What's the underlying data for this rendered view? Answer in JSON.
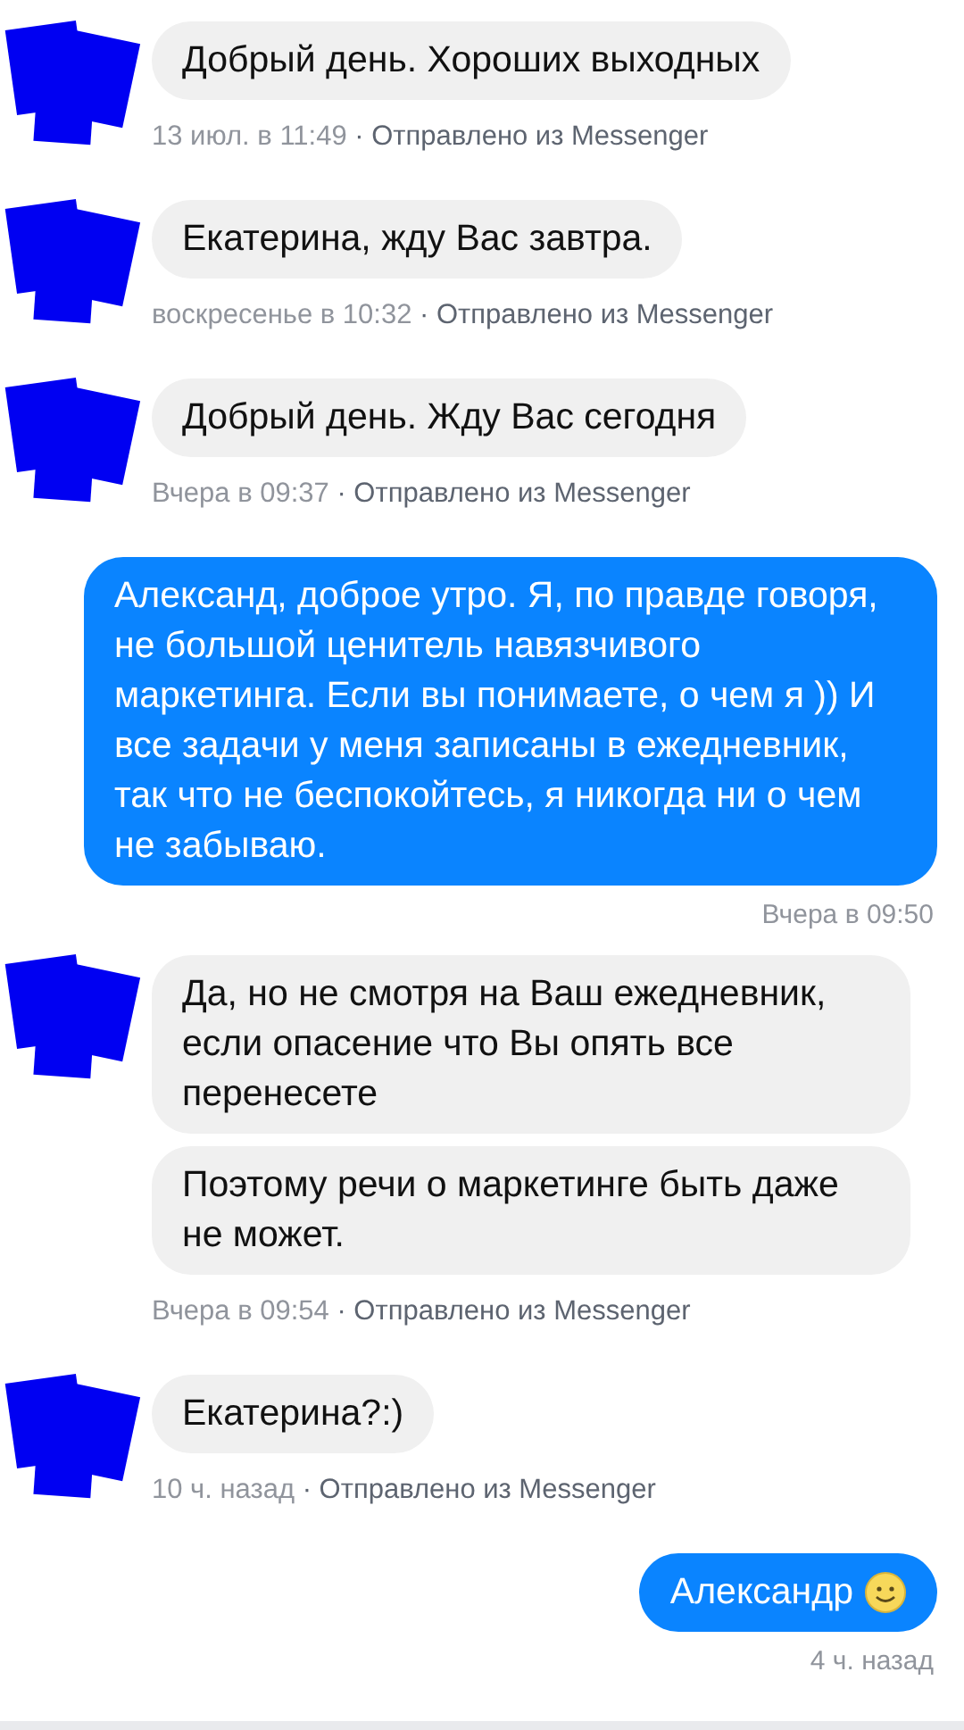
{
  "messages": [
    {
      "kind": "incoming",
      "bubbles": [
        "Добрый день. Хороших выходных"
      ],
      "time": "13 июл. в 11:49",
      "source": "· Отправлено из Messenger"
    },
    {
      "kind": "incoming",
      "bubbles": [
        "Екатерина, жду Вас завтра."
      ],
      "time": "воскресенье в 10:32",
      "source": "· Отправлено из Messenger"
    },
    {
      "kind": "incoming",
      "bubbles": [
        "Добрый день. Жду Вас сегодня"
      ],
      "time": "Вчера в 09:37",
      "source": "· Отправлено из Messenger"
    },
    {
      "kind": "outgoing",
      "bubbles": [
        "Александ, доброе утро. Я, по правде говоря, не большой ценитель навязчивого маркетинга. Если вы понимаете, о чем я )) И все задачи у меня записаны в ежедневник, так что не беспокойтесь, я никогда ни о чем не забываю."
      ],
      "time": "Вчера в 09:50",
      "emoji": false
    },
    {
      "kind": "incoming",
      "bubbles": [
        "Да, но не смотря на Ваш ежедневник, если опасение что Вы опять все перенесете",
        "Поэтому речи о маркетинге быть даже не может."
      ],
      "time": "Вчера в 09:54",
      "source": "· Отправлено из Messenger"
    },
    {
      "kind": "incoming",
      "bubbles": [
        "Екатерина?:)"
      ],
      "time": "10 ч. назад",
      "source": "· Отправлено из Messenger"
    },
    {
      "kind": "outgoing",
      "bubbles": [
        "Александр"
      ],
      "time": "4 ч. назад",
      "emoji": true
    }
  ]
}
